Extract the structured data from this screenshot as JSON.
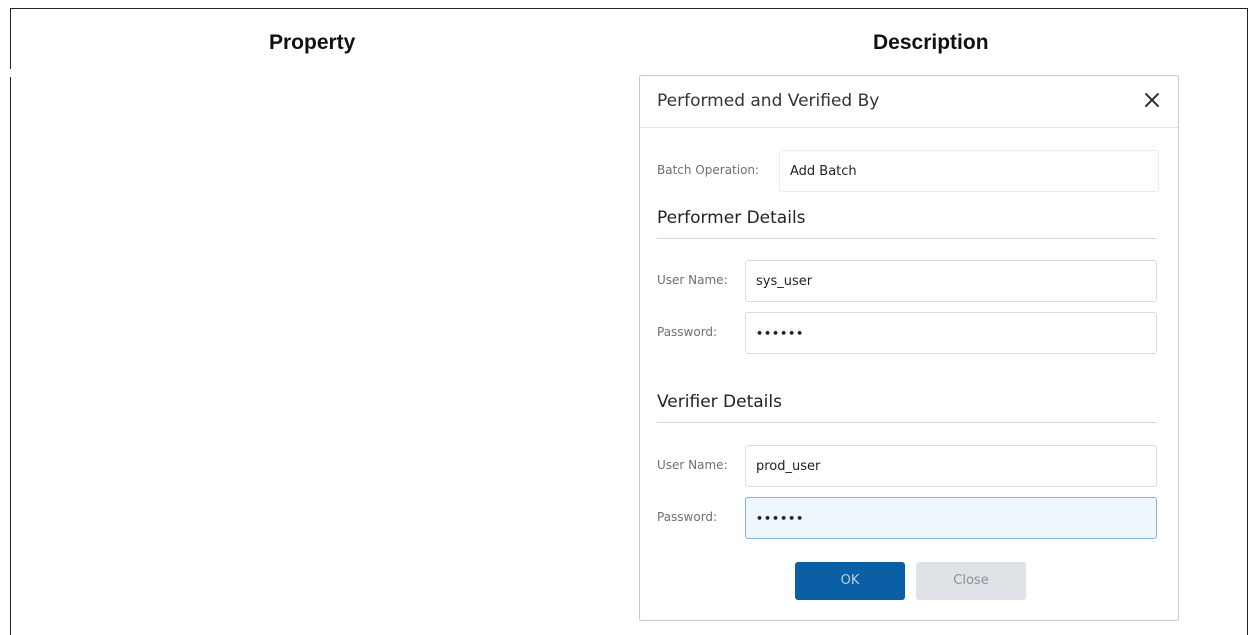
{
  "table": {
    "headers": [
      "Property",
      "Description"
    ]
  },
  "dialog": {
    "title": "Performed and Verified By",
    "close_icon": "close-icon",
    "batch_operation": {
      "label": "Batch Operation:",
      "value": "Add Batch"
    },
    "performer": {
      "section_title": "Performer Details",
      "user_name_label": "User Name:",
      "user_name_value": "sys_user",
      "password_label": "Password:",
      "password_value": "••••••"
    },
    "verifier": {
      "section_title": "Verifier Details",
      "user_name_label": "User Name:",
      "user_name_value": "prod_user",
      "password_label": "Password:",
      "password_value": "••••••"
    },
    "buttons": {
      "ok_label": "OK",
      "close_label": "Close"
    }
  },
  "colors": {
    "primary_button": "#0b5fa5",
    "secondary_button": "#dfe3e7",
    "focused_field": "#eef8fc"
  }
}
